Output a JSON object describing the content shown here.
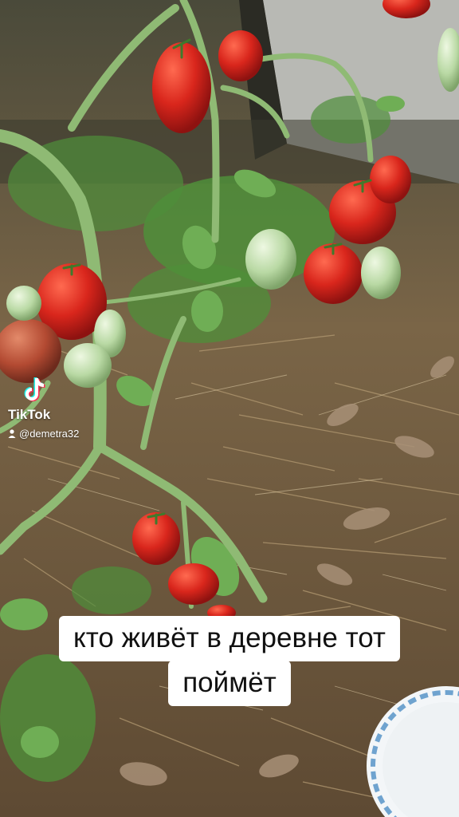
{
  "watermark": {
    "app_name": "TikTok",
    "username": "@demetra32",
    "logo_icon": "tiktok-logo-icon",
    "user_icon": "person-icon"
  },
  "caption": {
    "line1": "кто живёт в деревне тот",
    "line2": "поймёт"
  },
  "colors": {
    "tomato_red": "#d9261c",
    "unripe_green": "#b9d9a4",
    "foliage_green": "#4f8f3a",
    "straw": "#8a7352",
    "caption_bg": "#ffffff"
  }
}
